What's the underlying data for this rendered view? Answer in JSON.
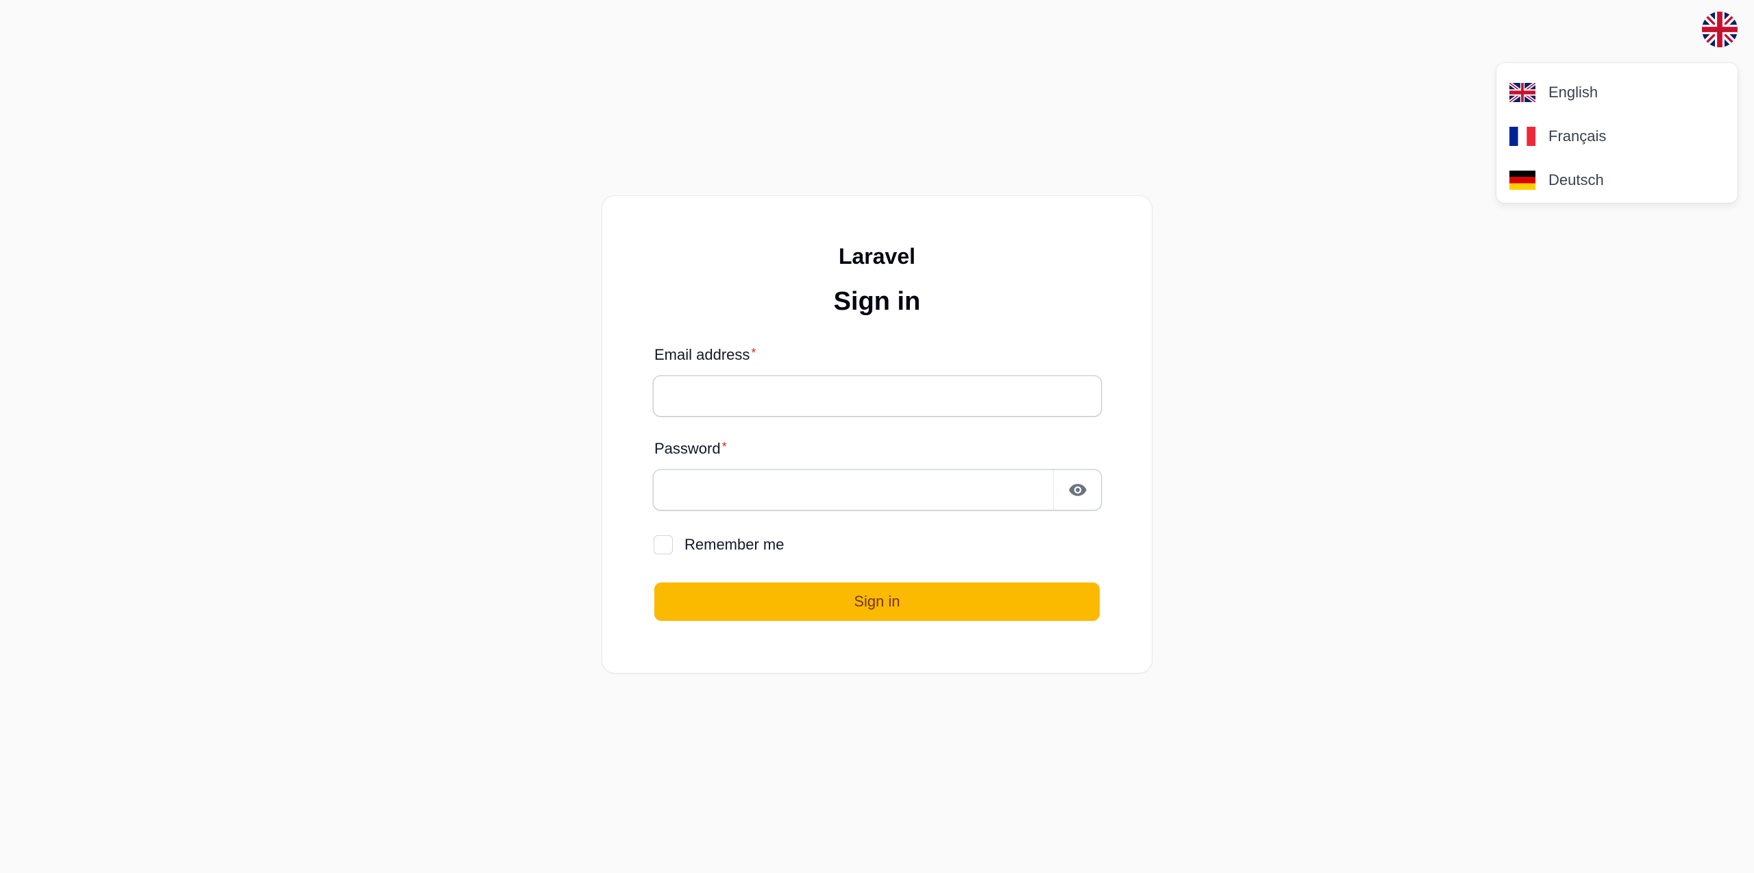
{
  "language_switcher": {
    "current_flag_icon": "uk-flag-icon",
    "menu_items": [
      {
        "label": "English",
        "flag_icon": "uk-flag-icon"
      },
      {
        "label": "Français",
        "flag_icon": "france-flag-icon"
      },
      {
        "label": "Deutsch",
        "flag_icon": "germany-flag-icon"
      }
    ]
  },
  "card": {
    "brand": "Laravel",
    "title": "Sign in",
    "email": {
      "label": "Email address",
      "required_mark": "*",
      "value": "",
      "placeholder": ""
    },
    "password": {
      "label": "Password",
      "required_mark": "*",
      "value": "",
      "placeholder": "",
      "toggle_icon": "eye-icon"
    },
    "remember": {
      "label": "Remember me",
      "checked": false
    },
    "submit_label": "Sign in"
  },
  "colors": {
    "background": "#fafafa",
    "primary": "#fbb900",
    "primary_text": "#78350f",
    "required": "#dc2626"
  }
}
